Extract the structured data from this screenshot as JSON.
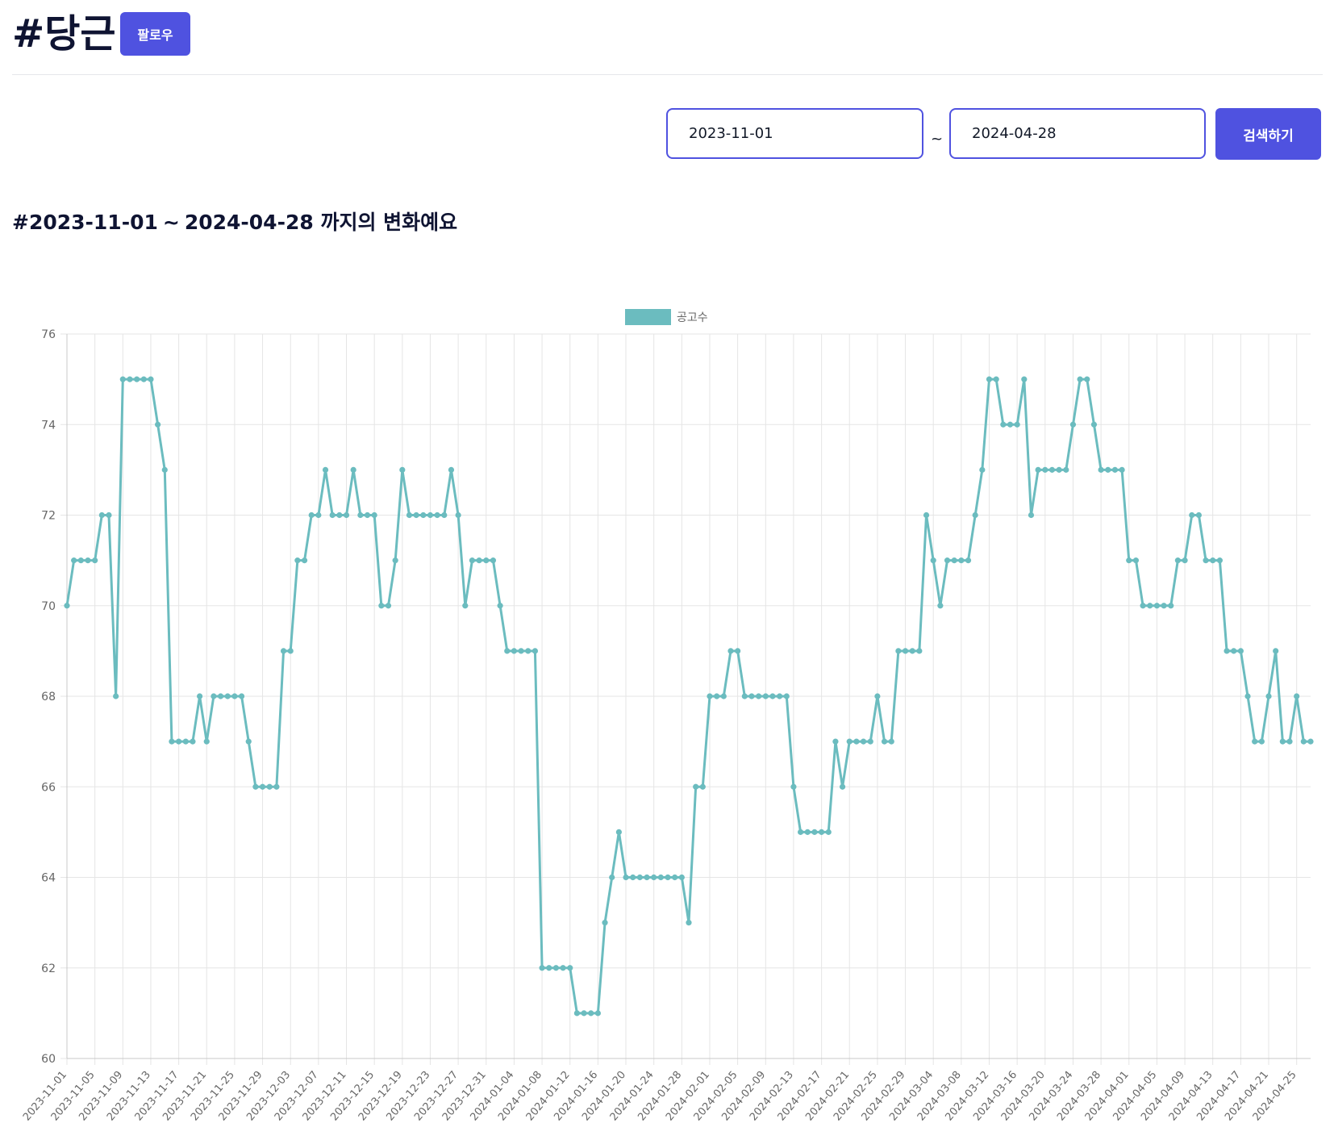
{
  "header": {
    "title": "#당근",
    "follow_label": "팔로우"
  },
  "search": {
    "start_date": "2023-11-01",
    "end_date": "2024-04-28",
    "separator": "~",
    "button_label": "검색하기"
  },
  "range_heading": {
    "prefix": "#",
    "start": "2023-11-01",
    "separator": "~",
    "end": "2024-04-28",
    "suffix": "까지의 변화예요"
  },
  "colors": {
    "accent": "#4f52e0",
    "series": "#6bbcbf",
    "grid": "#e5e5e5"
  },
  "chart_data": {
    "type": "line",
    "start_date": "2023-11-01",
    "tick_every_days": 4,
    "ylim": [
      60,
      76
    ],
    "y_ticks": [
      60,
      62,
      64,
      66,
      68,
      70,
      72,
      74,
      76
    ],
    "grid": true,
    "legend_position": "top-center",
    "x_tick_labels": [
      "2023-11-01",
      "2023-11-05",
      "2023-11-09",
      "2023-11-13",
      "2023-11-17",
      "2023-11-21",
      "2023-11-25",
      "2023-11-29",
      "2023-12-03",
      "2023-12-07",
      "2023-12-11",
      "2023-12-15",
      "2023-12-19",
      "2023-12-23",
      "2023-12-27",
      "2023-12-31",
      "2024-01-04",
      "2024-01-08",
      "2024-01-12",
      "2024-01-16",
      "2024-01-20",
      "2024-01-24",
      "2024-01-28",
      "2024-02-01",
      "2024-02-05",
      "2024-02-09",
      "2024-02-13",
      "2024-02-17",
      "2024-02-21",
      "2024-02-25",
      "2024-02-29",
      "2024-03-04",
      "2024-03-08",
      "2024-03-12",
      "2024-03-16",
      "2024-03-20",
      "2024-03-24",
      "2024-03-28",
      "2024-04-01",
      "2024-04-05",
      "2024-04-09",
      "2024-04-13",
      "2024-04-17",
      "2024-04-21",
      "2024-04-25"
    ],
    "series": [
      {
        "name": "공고수",
        "values": [
          70,
          71,
          71,
          71,
          71,
          72,
          72,
          68,
          75,
          75,
          75,
          75,
          75,
          74,
          73,
          67,
          67,
          67,
          67,
          68,
          67,
          68,
          68,
          68,
          68,
          68,
          67,
          66,
          66,
          66,
          66,
          69,
          69,
          71,
          71,
          72,
          72,
          73,
          72,
          72,
          72,
          73,
          72,
          72,
          72,
          70,
          70,
          71,
          73,
          72,
          72,
          72,
          72,
          72,
          72,
          73,
          72,
          70,
          71,
          71,
          71,
          71,
          70,
          69,
          69,
          69,
          69,
          69,
          62,
          62,
          62,
          62,
          62,
          61,
          61,
          61,
          61,
          63,
          64,
          65,
          64,
          64,
          64,
          64,
          64,
          64,
          64,
          64,
          64,
          63,
          66,
          66,
          68,
          68,
          68,
          69,
          69,
          68,
          68,
          68,
          68,
          68,
          68,
          68,
          66,
          65,
          65,
          65,
          65,
          65,
          67,
          66,
          67,
          67,
          67,
          67,
          68,
          67,
          67,
          69,
          69,
          69,
          69,
          72,
          71,
          70,
          71,
          71,
          71,
          71,
          72,
          73,
          75,
          75,
          74,
          74,
          74,
          75,
          72,
          73,
          73,
          73,
          73,
          73,
          74,
          75,
          75,
          74,
          73,
          73,
          73,
          73,
          71,
          71,
          70,
          70,
          70,
          70,
          70,
          71,
          71,
          72,
          72,
          71,
          71,
          71,
          69,
          69,
          69,
          68,
          67,
          67,
          68,
          69,
          67,
          67,
          68,
          67,
          67
        ]
      }
    ]
  }
}
